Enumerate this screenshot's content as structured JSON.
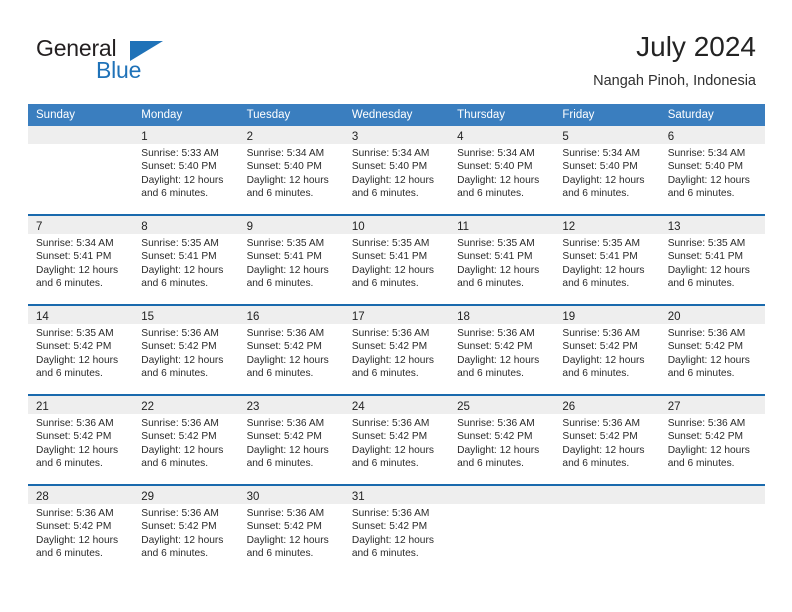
{
  "brand": {
    "name_top": "General",
    "name_bottom": "Blue",
    "accent_color": "#1f72b8"
  },
  "header": {
    "title": "July 2024",
    "subtitle": "Nangah Pinoh, Indonesia"
  },
  "calendar": {
    "header_bg": "#3a7ebf",
    "row_divider_color": "#1a6aad",
    "day_band_bg": "#eeeeee",
    "weekday_headers": [
      "Sunday",
      "Monday",
      "Tuesday",
      "Wednesday",
      "Thursday",
      "Friday",
      "Saturday"
    ],
    "weeks": [
      [
        {
          "day": "",
          "lines": []
        },
        {
          "day": "1",
          "lines": [
            "Sunrise: 5:33 AM",
            "Sunset: 5:40 PM",
            "Daylight: 12 hours",
            "and 6 minutes."
          ]
        },
        {
          "day": "2",
          "lines": [
            "Sunrise: 5:34 AM",
            "Sunset: 5:40 PM",
            "Daylight: 12 hours",
            "and 6 minutes."
          ]
        },
        {
          "day": "3",
          "lines": [
            "Sunrise: 5:34 AM",
            "Sunset: 5:40 PM",
            "Daylight: 12 hours",
            "and 6 minutes."
          ]
        },
        {
          "day": "4",
          "lines": [
            "Sunrise: 5:34 AM",
            "Sunset: 5:40 PM",
            "Daylight: 12 hours",
            "and 6 minutes."
          ]
        },
        {
          "day": "5",
          "lines": [
            "Sunrise: 5:34 AM",
            "Sunset: 5:40 PM",
            "Daylight: 12 hours",
            "and 6 minutes."
          ]
        },
        {
          "day": "6",
          "lines": [
            "Sunrise: 5:34 AM",
            "Sunset: 5:40 PM",
            "Daylight: 12 hours",
            "and 6 minutes."
          ]
        }
      ],
      [
        {
          "day": "7",
          "lines": [
            "Sunrise: 5:34 AM",
            "Sunset: 5:41 PM",
            "Daylight: 12 hours",
            "and 6 minutes."
          ]
        },
        {
          "day": "8",
          "lines": [
            "Sunrise: 5:35 AM",
            "Sunset: 5:41 PM",
            "Daylight: 12 hours",
            "and 6 minutes."
          ]
        },
        {
          "day": "9",
          "lines": [
            "Sunrise: 5:35 AM",
            "Sunset: 5:41 PM",
            "Daylight: 12 hours",
            "and 6 minutes."
          ]
        },
        {
          "day": "10",
          "lines": [
            "Sunrise: 5:35 AM",
            "Sunset: 5:41 PM",
            "Daylight: 12 hours",
            "and 6 minutes."
          ]
        },
        {
          "day": "11",
          "lines": [
            "Sunrise: 5:35 AM",
            "Sunset: 5:41 PM",
            "Daylight: 12 hours",
            "and 6 minutes."
          ]
        },
        {
          "day": "12",
          "lines": [
            "Sunrise: 5:35 AM",
            "Sunset: 5:41 PM",
            "Daylight: 12 hours",
            "and 6 minutes."
          ]
        },
        {
          "day": "13",
          "lines": [
            "Sunrise: 5:35 AM",
            "Sunset: 5:41 PM",
            "Daylight: 12 hours",
            "and 6 minutes."
          ]
        }
      ],
      [
        {
          "day": "14",
          "lines": [
            "Sunrise: 5:35 AM",
            "Sunset: 5:42 PM",
            "Daylight: 12 hours",
            "and 6 minutes."
          ]
        },
        {
          "day": "15",
          "lines": [
            "Sunrise: 5:36 AM",
            "Sunset: 5:42 PM",
            "Daylight: 12 hours",
            "and 6 minutes."
          ]
        },
        {
          "day": "16",
          "lines": [
            "Sunrise: 5:36 AM",
            "Sunset: 5:42 PM",
            "Daylight: 12 hours",
            "and 6 minutes."
          ]
        },
        {
          "day": "17",
          "lines": [
            "Sunrise: 5:36 AM",
            "Sunset: 5:42 PM",
            "Daylight: 12 hours",
            "and 6 minutes."
          ]
        },
        {
          "day": "18",
          "lines": [
            "Sunrise: 5:36 AM",
            "Sunset: 5:42 PM",
            "Daylight: 12 hours",
            "and 6 minutes."
          ]
        },
        {
          "day": "19",
          "lines": [
            "Sunrise: 5:36 AM",
            "Sunset: 5:42 PM",
            "Daylight: 12 hours",
            "and 6 minutes."
          ]
        },
        {
          "day": "20",
          "lines": [
            "Sunrise: 5:36 AM",
            "Sunset: 5:42 PM",
            "Daylight: 12 hours",
            "and 6 minutes."
          ]
        }
      ],
      [
        {
          "day": "21",
          "lines": [
            "Sunrise: 5:36 AM",
            "Sunset: 5:42 PM",
            "Daylight: 12 hours",
            "and 6 minutes."
          ]
        },
        {
          "day": "22",
          "lines": [
            "Sunrise: 5:36 AM",
            "Sunset: 5:42 PM",
            "Daylight: 12 hours",
            "and 6 minutes."
          ]
        },
        {
          "day": "23",
          "lines": [
            "Sunrise: 5:36 AM",
            "Sunset: 5:42 PM",
            "Daylight: 12 hours",
            "and 6 minutes."
          ]
        },
        {
          "day": "24",
          "lines": [
            "Sunrise: 5:36 AM",
            "Sunset: 5:42 PM",
            "Daylight: 12 hours",
            "and 6 minutes."
          ]
        },
        {
          "day": "25",
          "lines": [
            "Sunrise: 5:36 AM",
            "Sunset: 5:42 PM",
            "Daylight: 12 hours",
            "and 6 minutes."
          ]
        },
        {
          "day": "26",
          "lines": [
            "Sunrise: 5:36 AM",
            "Sunset: 5:42 PM",
            "Daylight: 12 hours",
            "and 6 minutes."
          ]
        },
        {
          "day": "27",
          "lines": [
            "Sunrise: 5:36 AM",
            "Sunset: 5:42 PM",
            "Daylight: 12 hours",
            "and 6 minutes."
          ]
        }
      ],
      [
        {
          "day": "28",
          "lines": [
            "Sunrise: 5:36 AM",
            "Sunset: 5:42 PM",
            "Daylight: 12 hours",
            "and 6 minutes."
          ]
        },
        {
          "day": "29",
          "lines": [
            "Sunrise: 5:36 AM",
            "Sunset: 5:42 PM",
            "Daylight: 12 hours",
            "and 6 minutes."
          ]
        },
        {
          "day": "30",
          "lines": [
            "Sunrise: 5:36 AM",
            "Sunset: 5:42 PM",
            "Daylight: 12 hours",
            "and 6 minutes."
          ]
        },
        {
          "day": "31",
          "lines": [
            "Sunrise: 5:36 AM",
            "Sunset: 5:42 PM",
            "Daylight: 12 hours",
            "and 6 minutes."
          ]
        },
        {
          "day": "",
          "lines": []
        },
        {
          "day": "",
          "lines": []
        },
        {
          "day": "",
          "lines": []
        }
      ]
    ]
  }
}
